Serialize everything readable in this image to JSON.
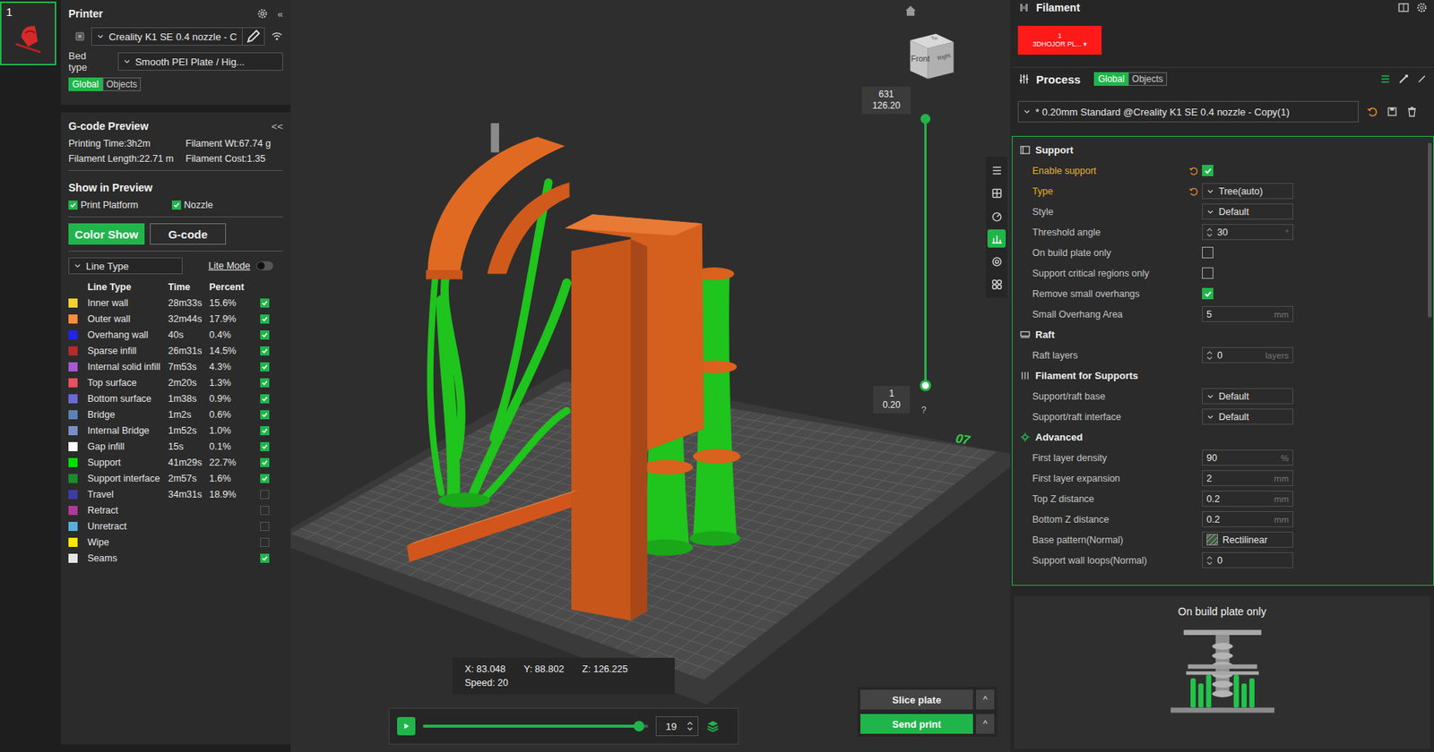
{
  "plates": [
    {
      "label": "1",
      "selected": true
    }
  ],
  "printer": {
    "title": "Printer",
    "collapse": "«",
    "preset": "Creality K1 SE 0.4 nozzle - C",
    "bed_label": "Bed type",
    "bed_value": "Smooth PEI Plate / Hig...",
    "scope_tabs": [
      {
        "label": "Global",
        "selected": true
      },
      {
        "label": "Objects",
        "selected": false
      }
    ]
  },
  "gcode_preview": {
    "title": "G-code Preview",
    "collapse": "<<",
    "stats": [
      "Printing Time:3h2m",
      "Filament Wt:67.74 g",
      "Filament Length:22.71 m",
      "Filament Cost:1.35"
    ]
  },
  "show_in_preview": {
    "title": "Show in Preview",
    "options": [
      {
        "label": "Print Platform",
        "checked": true
      },
      {
        "label": "Nozzle",
        "checked": true
      }
    ]
  },
  "view_modes": [
    {
      "label": "Color Show",
      "selected": true
    },
    {
      "label": "G-code",
      "selected": false
    }
  ],
  "view_type": {
    "value": "Line Type"
  },
  "lite_mode": {
    "label": "Lite Mode",
    "on": false
  },
  "line_table": {
    "columns": [
      "Line Type",
      "Time",
      "Percent"
    ],
    "rows": [
      {
        "name": "Inner wall",
        "time": "28m33s",
        "percent": "15.6%",
        "color": "#f5d327",
        "checked": true
      },
      {
        "name": "Outer wall",
        "time": "32m44s",
        "percent": "17.9%",
        "color": "#ff8c3a",
        "checked": true
      },
      {
        "name": "Overhang wall",
        "time": "40s",
        "percent": "0.4%",
        "color": "#2222ee",
        "checked": true
      },
      {
        "name": "Sparse infill",
        "time": "26m31s",
        "percent": "14.5%",
        "color": "#b52a2a",
        "checked": true
      },
      {
        "name": "Internal solid infill",
        "time": "7m53s",
        "percent": "4.3%",
        "color": "#a65ad2",
        "checked": true
      },
      {
        "name": "Top surface",
        "time": "2m20s",
        "percent": "1.3%",
        "color": "#e8505f",
        "checked": true
      },
      {
        "name": "Bottom surface",
        "time": "1m38s",
        "percent": "0.9%",
        "color": "#6a6ad6",
        "checked": true
      },
      {
        "name": "Bridge",
        "time": "1m2s",
        "percent": "0.6%",
        "color": "#5b82b7",
        "checked": true
      },
      {
        "name": "Internal Bridge",
        "time": "1m52s",
        "percent": "1.0%",
        "color": "#7a8fc9",
        "checked": true
      },
      {
        "name": "Gap infill",
        "time": "15s",
        "percent": "0.1%",
        "color": "#ffffff",
        "checked": true
      },
      {
        "name": "Support",
        "time": "41m29s",
        "percent": "22.7%",
        "color": "#00e000",
        "checked": true
      },
      {
        "name": "Support interface",
        "time": "2m57s",
        "percent": "1.6%",
        "color": "#1a8c2a",
        "checked": true
      },
      {
        "name": "Travel",
        "time": "34m31s",
        "percent": "18.9%",
        "color": "#3c3ca8",
        "checked": false
      },
      {
        "name": "Retract",
        "time": "",
        "percent": "",
        "color": "#b03a9a",
        "checked": false
      },
      {
        "name": "Unretract",
        "time": "",
        "percent": "",
        "color": "#5ab0dc",
        "checked": false
      },
      {
        "name": "Wipe",
        "time": "",
        "percent": "",
        "color": "#ffe800",
        "checked": false
      },
      {
        "name": "Seams",
        "time": "",
        "percent": "",
        "color": "#e6e6e6",
        "checked": true
      }
    ]
  },
  "viewport": {
    "bed_mark": "07",
    "view_cube": {
      "front": "Front",
      "right": "Right",
      "top": "Top"
    },
    "layer_slider": {
      "top_label": [
        "631",
        "126.20"
      ],
      "bottom_label": [
        "1",
        "0.20"
      ],
      "help": "?",
      "upper_level": 1,
      "lower_level": 0
    },
    "coords": {
      "x": "X: 83.048",
      "y": "Y: 88.802",
      "z": "Z: 126.225",
      "speed": "Speed: 20"
    },
    "move_slider": {
      "level": 0.96,
      "value": "19"
    },
    "view_tools": [
      {
        "selected": false
      },
      {
        "selected": false
      },
      {
        "selected": false
      },
      {
        "selected": true
      },
      {
        "selected": false
      },
      {
        "selected": false
      }
    ]
  },
  "actions": [
    {
      "label": "Slice plate",
      "caret": "^",
      "primary": false
    },
    {
      "label": "Send print",
      "caret": "^",
      "primary": true
    }
  ],
  "filament": {
    "title": "Filament",
    "items": [
      {
        "index": "1",
        "label": "3DHOJOR PL...",
        "caret": "▾",
        "color": "#ff1a1a"
      }
    ]
  },
  "process": {
    "title": "Process",
    "scope_tabs": [
      {
        "label": "Global",
        "selected": true
      },
      {
        "label": "Objects",
        "selected": false
      }
    ],
    "preset": "* 0.20mm  Standard @Creality K1 SE 0.4 nozzle - Copy(1)"
  },
  "settings": {
    "sections": [
      {
        "title": "Support",
        "rows": [
          {
            "label": "Enable support",
            "kind": "checkbox",
            "checked": true,
            "modified": true
          },
          {
            "label": "Type",
            "kind": "select",
            "value": "Tree(auto)",
            "modified": true
          },
          {
            "label": "Style",
            "kind": "select",
            "value": "Default",
            "modified": false
          },
          {
            "label": "Threshold angle",
            "kind": "spin",
            "value": "30",
            "unit": "°",
            "modified": false
          },
          {
            "label": "On build plate only",
            "kind": "checkbox",
            "checked": false,
            "modified": false
          },
          {
            "label": "Support critical regions only",
            "kind": "checkbox",
            "checked": false,
            "modified": false
          },
          {
            "label": "Remove small overhangs",
            "kind": "checkbox",
            "checked": true,
            "modified": false
          },
          {
            "label": "Small Overhang Area",
            "kind": "number",
            "value": "5",
            "unit": "mm",
            "modified": false
          }
        ]
      },
      {
        "title": "Raft",
        "rows": [
          {
            "label": "Raft layers",
            "kind": "spin",
            "value": "0",
            "unit": "layers",
            "modified": false
          }
        ]
      },
      {
        "title": "Filament for Supports",
        "rows": [
          {
            "label": "Support/raft base",
            "kind": "select",
            "value": "Default",
            "modified": false
          },
          {
            "label": "Support/raft interface",
            "kind": "select",
            "value": "Default",
            "modified": false
          }
        ]
      },
      {
        "title": "Advanced",
        "rows": [
          {
            "label": "First layer density",
            "kind": "number",
            "value": "90",
            "unit": "%",
            "modified": false
          },
          {
            "label": "First layer expansion",
            "kind": "number",
            "value": "2",
            "unit": "mm",
            "modified": false
          },
          {
            "label": "Top Z distance",
            "kind": "number",
            "value": "0.2",
            "unit": "mm",
            "modified": false
          },
          {
            "label": "Bottom Z distance",
            "kind": "number",
            "value": "0.2",
            "unit": "mm",
            "modified": false
          },
          {
            "label": "Base pattern(Normal)",
            "kind": "pattern",
            "value": "Rectilinear",
            "modified": false
          },
          {
            "label": "Support wall loops(Normal)",
            "kind": "spin",
            "value": "0",
            "modified": false
          }
        ]
      }
    ]
  },
  "option_preview": {
    "title": "On build plate only"
  }
}
